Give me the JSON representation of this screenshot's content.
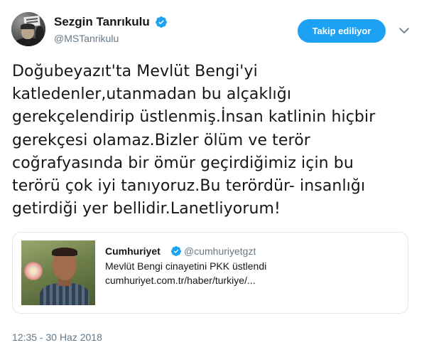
{
  "author": {
    "name": "Sezgin Tanrıkulu",
    "handle": "@MSTanrikulu",
    "verified": true
  },
  "follow_button": {
    "label": "Takip ediliyor"
  },
  "tweet": {
    "text": "Doğubeyazıt'ta Mevlüt Bengi'yi\nkatledenler,utanmadan bu alçaklığı\ngerekçelendirip üstlenmiş.İnsan katlinin hiçbir\ngerekçesi olamaz.Bizler ölüm ve terör\ncoğrafyasında bir ömür geçirdiğimiz için bu\nterörü çok iyi tanıyoruz.Bu terördür- insanlığı\ngetirdiği yer bellidir.Lanetliyorum!",
    "timestamp": "12:35 - 30 Haz 2018"
  },
  "quoted_tweet": {
    "name": "Cumhuriyet",
    "handle": "@cumhuriyetgzt",
    "verified": true,
    "text": "Mevlüt Bengi cinayetini PKK üstlendi\ncumhuriyet.com.tr/haber/turkiye/..."
  },
  "colors": {
    "accent": "#1da1f2",
    "text": "#14171a",
    "secondary_text": "#657786",
    "border": "#e1e8ed"
  },
  "icons": {
    "verified": "verified-badge-icon",
    "caret": "chevron-down-icon"
  }
}
